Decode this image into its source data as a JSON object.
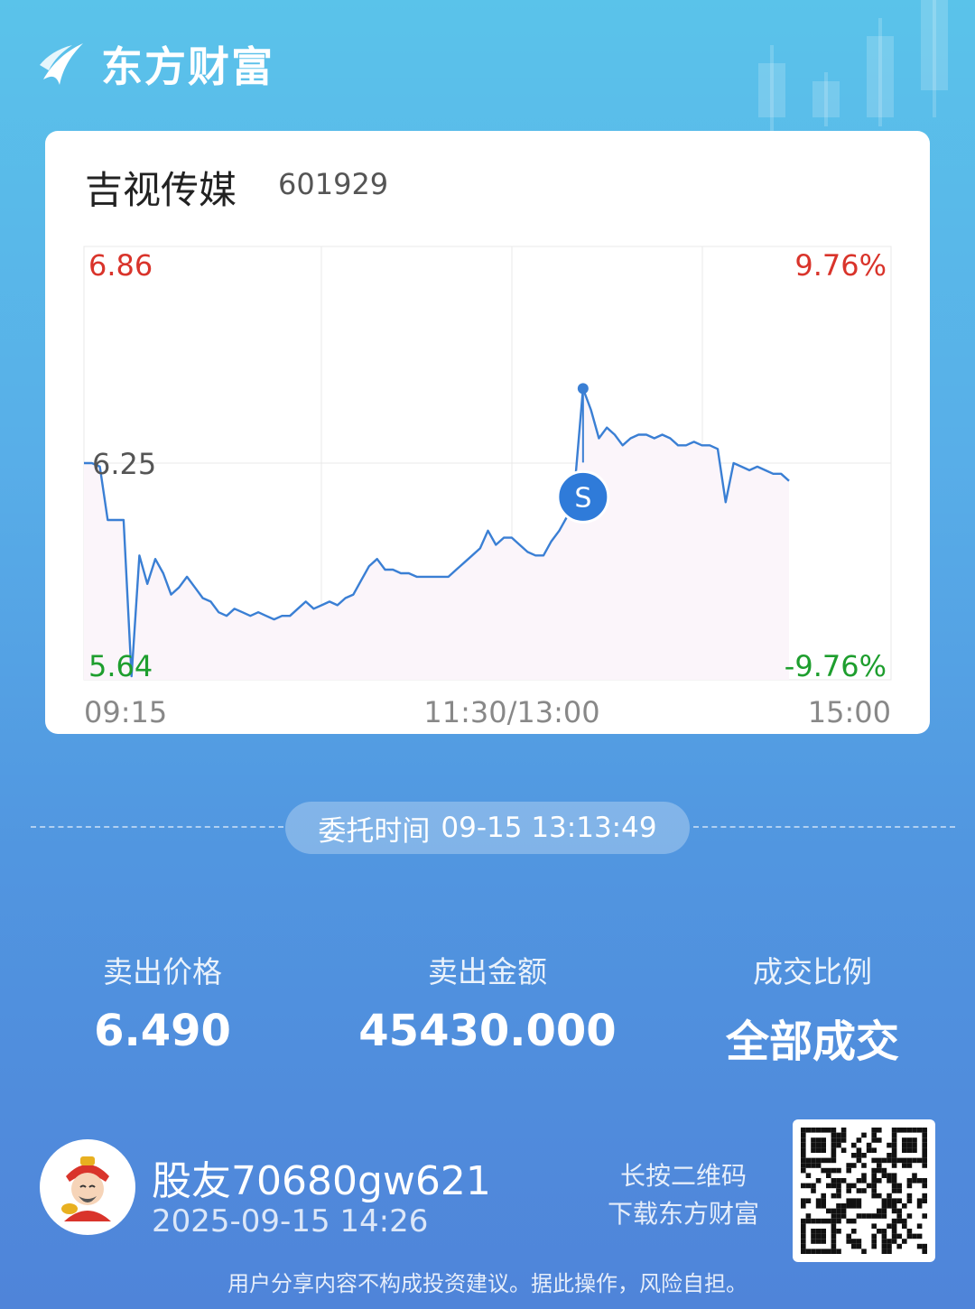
{
  "brand": {
    "name": "东方财富"
  },
  "stock": {
    "name": "吉视传媒",
    "code": "601929"
  },
  "chart_data": {
    "type": "line",
    "y_top": "6.86",
    "y_mid": "6.25",
    "y_bottom": "5.64",
    "pct_top": "9.76%",
    "pct_bottom": "-9.76%",
    "x_left": "09:15",
    "x_mid": "11:30/13:00",
    "x_right": "15:00",
    "ylim": [
      5.64,
      6.86
    ],
    "pre_close": 6.25,
    "marker": {
      "label": "S",
      "time": "13:13",
      "price": 6.49
    },
    "series": [
      {
        "values": [
          6.25,
          6.25,
          6.24,
          6.09,
          6.09,
          6.09,
          5.65,
          5.99,
          5.91,
          5.98,
          5.94,
          5.88,
          5.9,
          5.93,
          5.9,
          5.87,
          5.86,
          5.83,
          5.82,
          5.84,
          5.83,
          5.82,
          5.83,
          5.82,
          5.81,
          5.82,
          5.82,
          5.84,
          5.86,
          5.84,
          5.85,
          5.86,
          5.85,
          5.87,
          5.88,
          5.92,
          5.96,
          5.98,
          5.95,
          5.95,
          5.94,
          5.94,
          5.93,
          5.93,
          5.93,
          5.93,
          5.93,
          5.95,
          5.97,
          5.99,
          6.01,
          6.06,
          6.02,
          6.04,
          6.04,
          6.02,
          6.0,
          5.99,
          5.99,
          6.03,
          6.06,
          6.1,
          6.2,
          6.46,
          6.4,
          6.32,
          6.35,
          6.33,
          6.3,
          6.32,
          6.33,
          6.33,
          6.32,
          6.33,
          6.32,
          6.3,
          6.3,
          6.31,
          6.3,
          6.3,
          6.29,
          6.14,
          6.25,
          6.24,
          6.23,
          6.24,
          6.23,
          6.22,
          6.22,
          6.2
        ],
        "color": "#3a7fd4"
      }
    ]
  },
  "order": {
    "label": "委托时间",
    "value": "09-15 13:13:49"
  },
  "stats": [
    {
      "label": "卖出价格",
      "value": "6.490"
    },
    {
      "label": "卖出金额",
      "value": "45430.000"
    },
    {
      "label": "成交比例",
      "value": "全部成交"
    }
  ],
  "user": {
    "name": "股友70680gw621",
    "time": "2025-09-15 14:26"
  },
  "qr": {
    "line1": "长按二维码",
    "line2": "下载东方财富"
  },
  "disclaimer": "用户分享内容不构成投资建议。据此操作，风险自担。",
  "colors": {
    "up": "#d9342b",
    "down": "#1e9e2e",
    "line": "#3a7fd4"
  }
}
